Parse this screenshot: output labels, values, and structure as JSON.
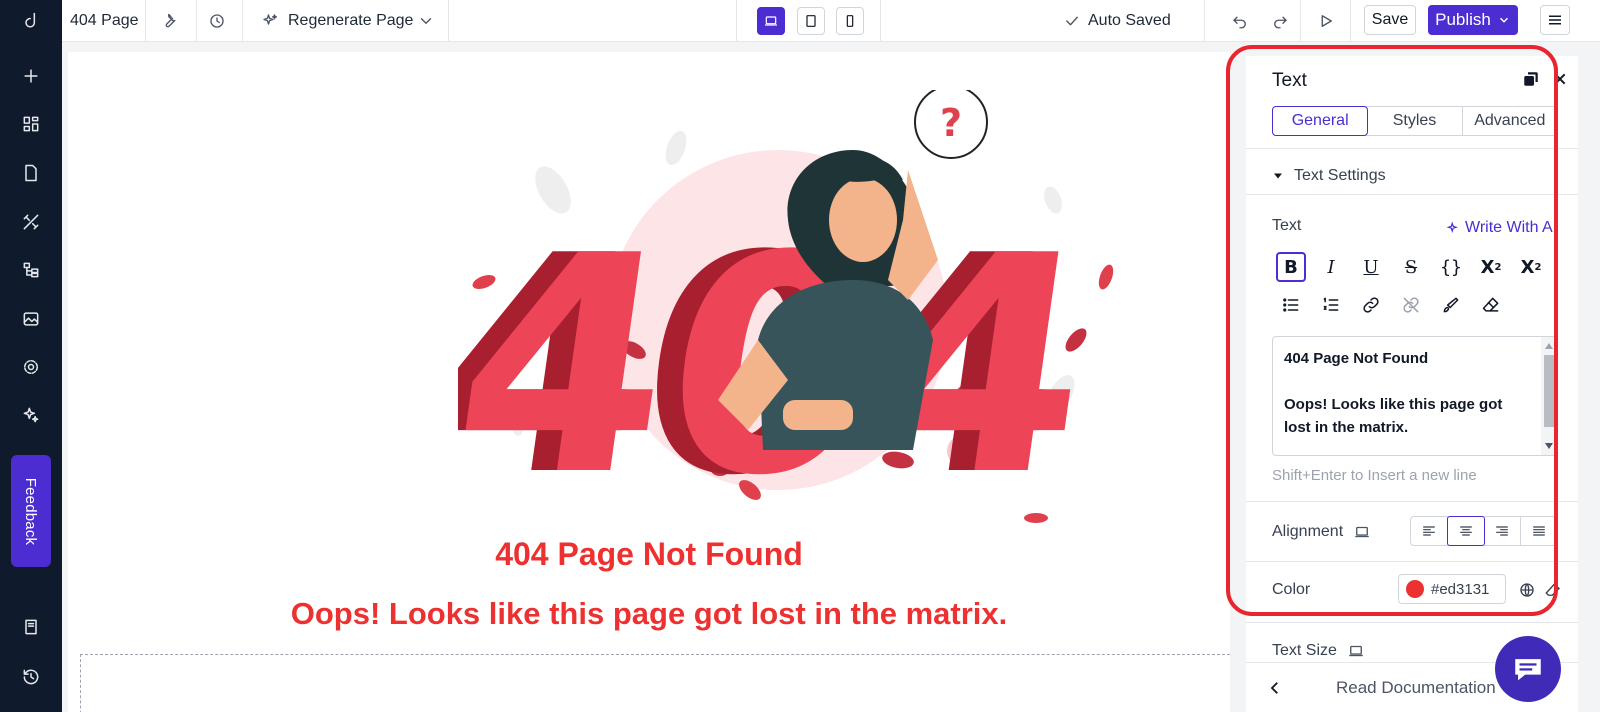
{
  "topbar": {
    "page_name": "404 Page",
    "regenerate_label": "Regenerate Page",
    "auto_saved_label": "Auto Saved",
    "save_label": "Save",
    "publish_label": "Publish"
  },
  "sidebar": {
    "feedback_label": "Feedback"
  },
  "canvas": {
    "heading": "404 Page Not Found",
    "subheading": "Oops! Looks like this page got lost in the matrix.",
    "illustration_text": "404",
    "illustration_question": "?"
  },
  "panel": {
    "title": "Text",
    "tabs": [
      {
        "label": "General"
      },
      {
        "label": "Styles"
      },
      {
        "label": "Advanced"
      }
    ],
    "section_title": "Text Settings",
    "text_label": "Text",
    "write_ai_label": "Write With AI",
    "editor_line1": "404 Page Not Found",
    "editor_line2": "Oops! Looks like this page got lost in the matrix.",
    "hint": "Shift+Enter to Insert a new line",
    "alignment_label": "Alignment",
    "color_label": "Color",
    "color_value": "#ed3131",
    "text_size_label": "Text Size",
    "read_docs_label": "Read Documentation"
  },
  "colors": {
    "accent": "#4b2dd1",
    "sidebar_bg": "#0f1b2d",
    "heading_red": "#ed3131",
    "highlight": "#e8262f"
  }
}
